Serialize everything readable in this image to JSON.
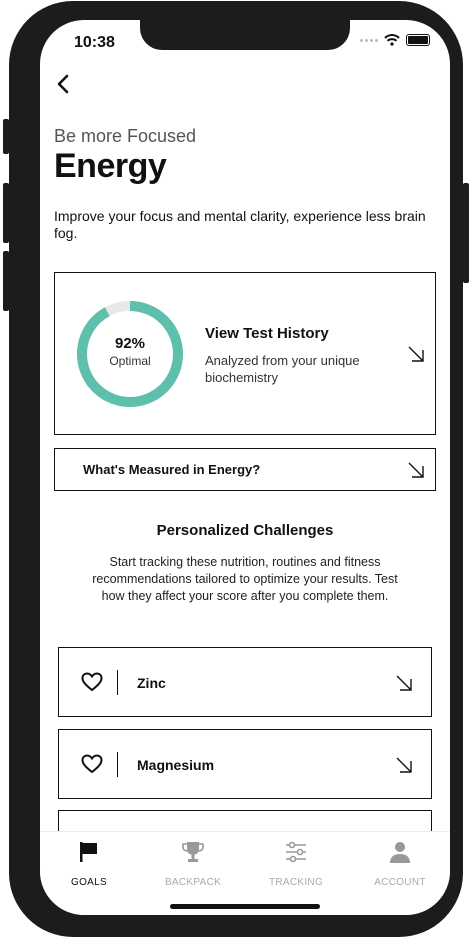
{
  "status_bar": {
    "time": "10:38"
  },
  "header": {
    "subtitle": "Be more Focused",
    "title": "Energy",
    "description": "Improve your focus and mental clarity, experience less brain fog."
  },
  "score_card": {
    "percent_label": "92%",
    "percent_value": 92,
    "status": "Optimal",
    "title": "View Test History",
    "subtitle": "Analyzed from your unique biochemistry",
    "ring_color": "#5fbfad",
    "ring_track_color": "#e8e8e8"
  },
  "measured": {
    "label": "What's Measured in Energy?"
  },
  "challenges": {
    "title": "Personalized Challenges",
    "description": "Start tracking these nutrition, routines and fitness recommendations tailored to optimize your results. Test how they affect your score after you complete them.",
    "items": [
      {
        "label": "Zinc"
      },
      {
        "label": "Magnesium"
      },
      {
        "label": ""
      }
    ]
  },
  "tabs": [
    {
      "label": "GOALS",
      "icon": "flag-icon",
      "active": true
    },
    {
      "label": "BACKPACK",
      "icon": "trophy-icon",
      "active": false
    },
    {
      "label": "TRACKING",
      "icon": "sliders-icon",
      "active": false
    },
    {
      "label": "ACCOUNT",
      "icon": "user-icon",
      "active": false
    }
  ]
}
